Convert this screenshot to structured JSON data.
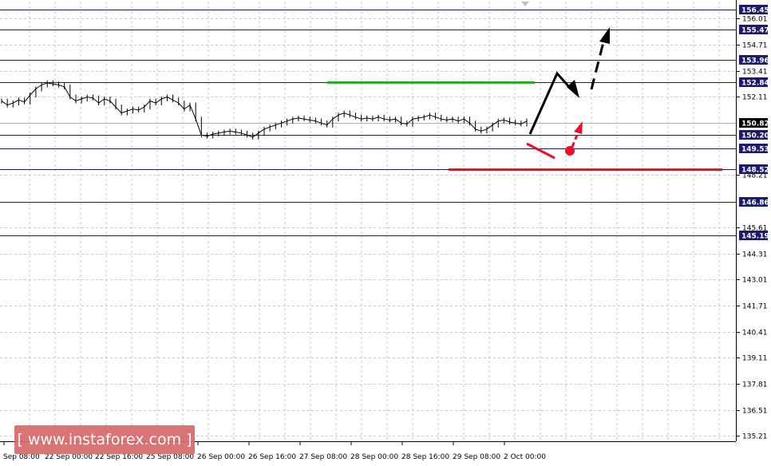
{
  "watermark": "[ www.instaforex.com ]",
  "chart_data": {
    "type": "line",
    "title": "",
    "xlabel": "",
    "ylabel": "",
    "ylim": [
      134.95,
      156.85
    ],
    "grid": true,
    "y_ticks": [
      156.01,
      154.71,
      153.41,
      152.11,
      148.21,
      145.61,
      144.31,
      143.01,
      141.71,
      140.41,
      139.11,
      137.81,
      136.51,
      135.21
    ],
    "x_ticks": [
      "Sep 08:00",
      "22 Sep 00:00",
      "22 Sep 16:00",
      "25 Sep 08:00",
      "26 Sep 00:00",
      "26 Sep 16:00",
      "27 Sep 08:00",
      "28 Sep 00:00",
      "28 Sep 16:00",
      "29 Sep 08:00",
      "2 Oct 00:00"
    ],
    "levels": [
      {
        "value": 156.45,
        "label": "156.45"
      },
      {
        "value": 155.47,
        "label": "155.47"
      },
      {
        "value": 153.96,
        "label": "153.96"
      },
      {
        "value": 152.84,
        "label": "152.84"
      },
      {
        "value": 150.2,
        "label": "150.20"
      },
      {
        "value": 149.53,
        "label": "149.53"
      },
      {
        "value": 148.52,
        "label": "148.52"
      },
      {
        "value": 146.86,
        "label": "146.86"
      },
      {
        "value": 145.19,
        "label": "145.19"
      }
    ],
    "current_price": {
      "value": 150.82,
      "label": "150.82"
    },
    "series": [
      {
        "values": [
          151.9,
          151.7,
          151.8,
          151.95,
          151.85,
          152.2,
          152.5,
          152.7,
          152.8,
          152.75,
          152.7,
          152.6,
          152.1,
          151.9,
          152.0,
          152.1,
          152.05,
          151.8,
          152.0,
          151.9,
          151.6,
          151.3,
          151.4,
          151.5,
          151.45,
          151.6,
          151.9,
          151.8,
          152.0,
          152.1,
          151.95,
          151.8,
          151.5,
          151.7,
          151.0,
          150.2,
          150.15,
          150.25,
          150.3,
          150.35,
          150.4,
          150.35,
          150.3,
          150.2,
          150.1,
          150.3,
          150.5,
          150.6,
          150.7,
          150.8,
          150.9,
          151.0,
          151.05,
          151.0,
          150.95,
          150.9,
          150.8,
          150.7,
          151.0,
          151.2,
          151.3,
          151.2,
          151.1,
          151.0,
          151.05,
          151.0,
          151.1,
          151.0,
          150.95,
          151.0,
          150.8,
          150.75,
          151.0,
          151.05,
          151.1,
          151.2,
          151.1,
          151.0,
          150.95,
          151.0,
          150.9,
          151.0,
          150.8,
          150.5,
          150.4,
          150.5,
          150.7,
          150.9,
          150.95,
          150.85,
          150.8,
          150.75,
          150.9
        ]
      }
    ]
  }
}
